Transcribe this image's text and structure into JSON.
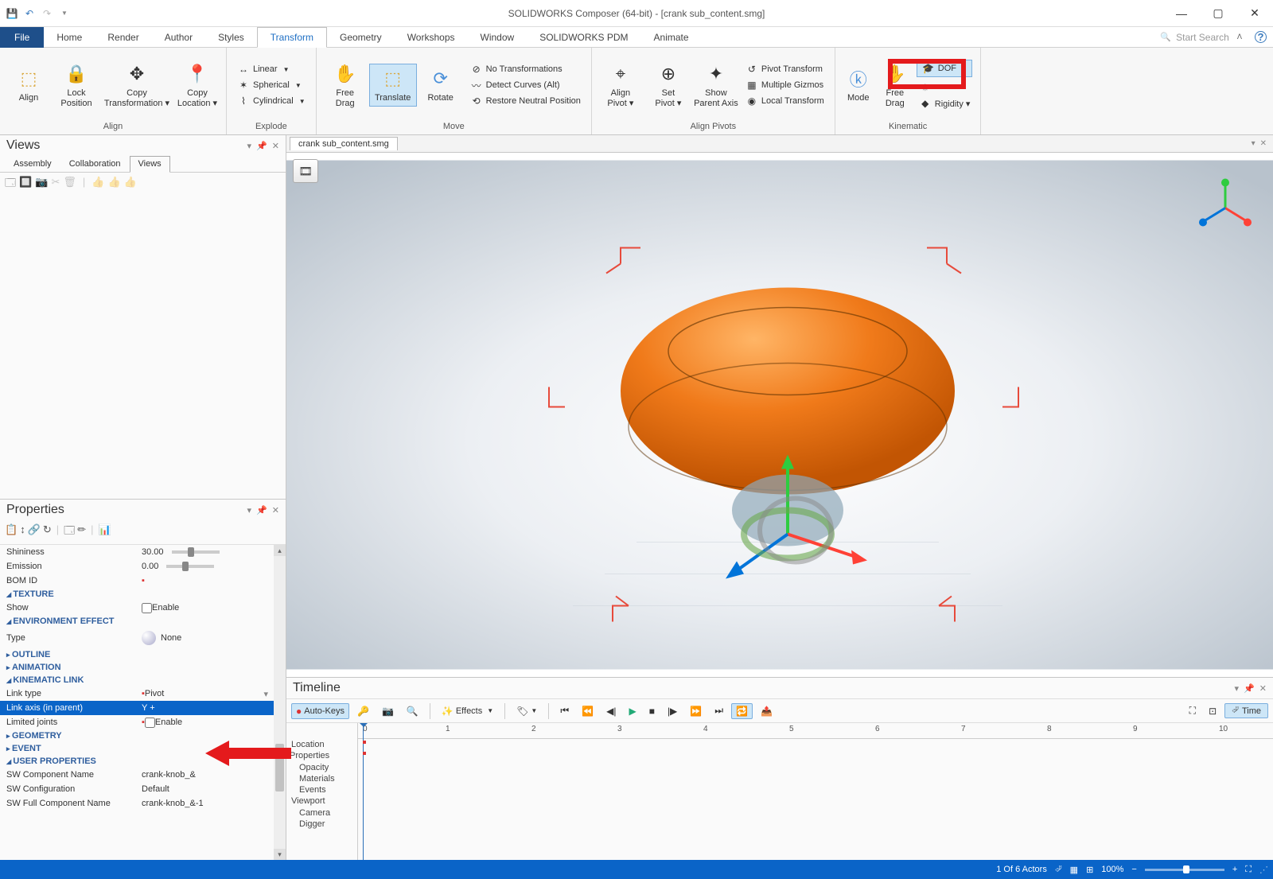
{
  "titlebar": {
    "app_title": "SOLIDWORKS Composer (64-bit) - [crank sub_content.smg]"
  },
  "ribbon_tabs": {
    "file": "File",
    "items": [
      "Home",
      "Render",
      "Author",
      "Styles",
      "Transform",
      "Geometry",
      "Workshops",
      "Window",
      "SOLIDWORKS PDM",
      "Animate"
    ],
    "active_index": 4,
    "search_placeholder": "Start Search"
  },
  "ribbon": {
    "align": {
      "label": "Align",
      "align": "Align",
      "lock_position": "Lock\nPosition",
      "copy_transformation": "Copy\nTransformation ▾",
      "copy_location": "Copy\nLocation ▾"
    },
    "explode": {
      "label": "Explode",
      "linear": "Linear",
      "spherical": "Spherical",
      "cylindrical": "Cylindrical"
    },
    "move": {
      "label": "Move",
      "free_drag": "Free\nDrag",
      "translate": "Translate",
      "rotate": "Rotate",
      "no_transforms": "No Transformations",
      "detect_curves": "Detect Curves (Alt)",
      "restore_neutral": "Restore Neutral Position"
    },
    "align_pivots": {
      "label": "Align Pivots",
      "align_pivot": "Align\nPivot ▾",
      "set_pivot": "Set\nPivot ▾",
      "show_parent_axis": "Show\nParent Axis",
      "pivot_transform": "Pivot Transform",
      "multiple_gizmos": "Multiple Gizmos",
      "local_transform": "Local Transform"
    },
    "kinematic": {
      "label": "Kinematic",
      "mode": "Mode",
      "free_drag": "Free\nDrag",
      "dof": "DOF",
      "rigidity": "Rigidity ▾"
    }
  },
  "views_panel": {
    "title": "Views",
    "tabs": [
      "Assembly",
      "Collaboration",
      "Views"
    ],
    "active_tab": 2
  },
  "doc_tab": "crank sub_content.smg",
  "properties_panel": {
    "title": "Properties",
    "rows": {
      "shininess": {
        "label": "Shininess",
        "value": "30.00"
      },
      "emission": {
        "label": "Emission",
        "value": "0.00"
      },
      "bom_id": {
        "label": "BOM ID",
        "value": ""
      },
      "texture": "TEXTURE",
      "show": {
        "label": "Show",
        "value": "Enable"
      },
      "env_effect": "ENVIRONMENT EFFECT",
      "type": {
        "label": "Type",
        "value": "None"
      },
      "outline": "OUTLINE",
      "animation": "ANIMATION",
      "kin_link": "KINEMATIC LINK",
      "link_type": {
        "label": "Link type",
        "value": "Pivot"
      },
      "link_axis": {
        "label": "Link axis    (in parent)",
        "value": "Y +"
      },
      "limited_joints": {
        "label": "Limited joints",
        "value": "Enable"
      },
      "geometry": "GEOMETRY",
      "event": "EVENT",
      "user_props": "USER PROPERTIES",
      "sw_comp_name": {
        "label": "SW Component Name",
        "value": "crank-knob_&"
      },
      "sw_config": {
        "label": "SW Configuration",
        "value": "Default"
      },
      "sw_full_name": {
        "label": "SW Full Component Name",
        "value": "crank-knob_&-1"
      }
    }
  },
  "timeline": {
    "title": "Timeline",
    "auto_keys": "Auto-Keys",
    "effects": "Effects",
    "time_label": "Time",
    "tracks": [
      "Location",
      "Properties",
      "Opacity",
      "Materials",
      "Events",
      "Viewport",
      "Camera",
      "Digger"
    ],
    "ruler_marks": [
      "0",
      "1",
      "2",
      "3",
      "4",
      "5",
      "6",
      "7",
      "8",
      "9",
      "10"
    ]
  },
  "statusbar": {
    "actors": "1 Of 6 Actors",
    "zoom": "100%"
  }
}
